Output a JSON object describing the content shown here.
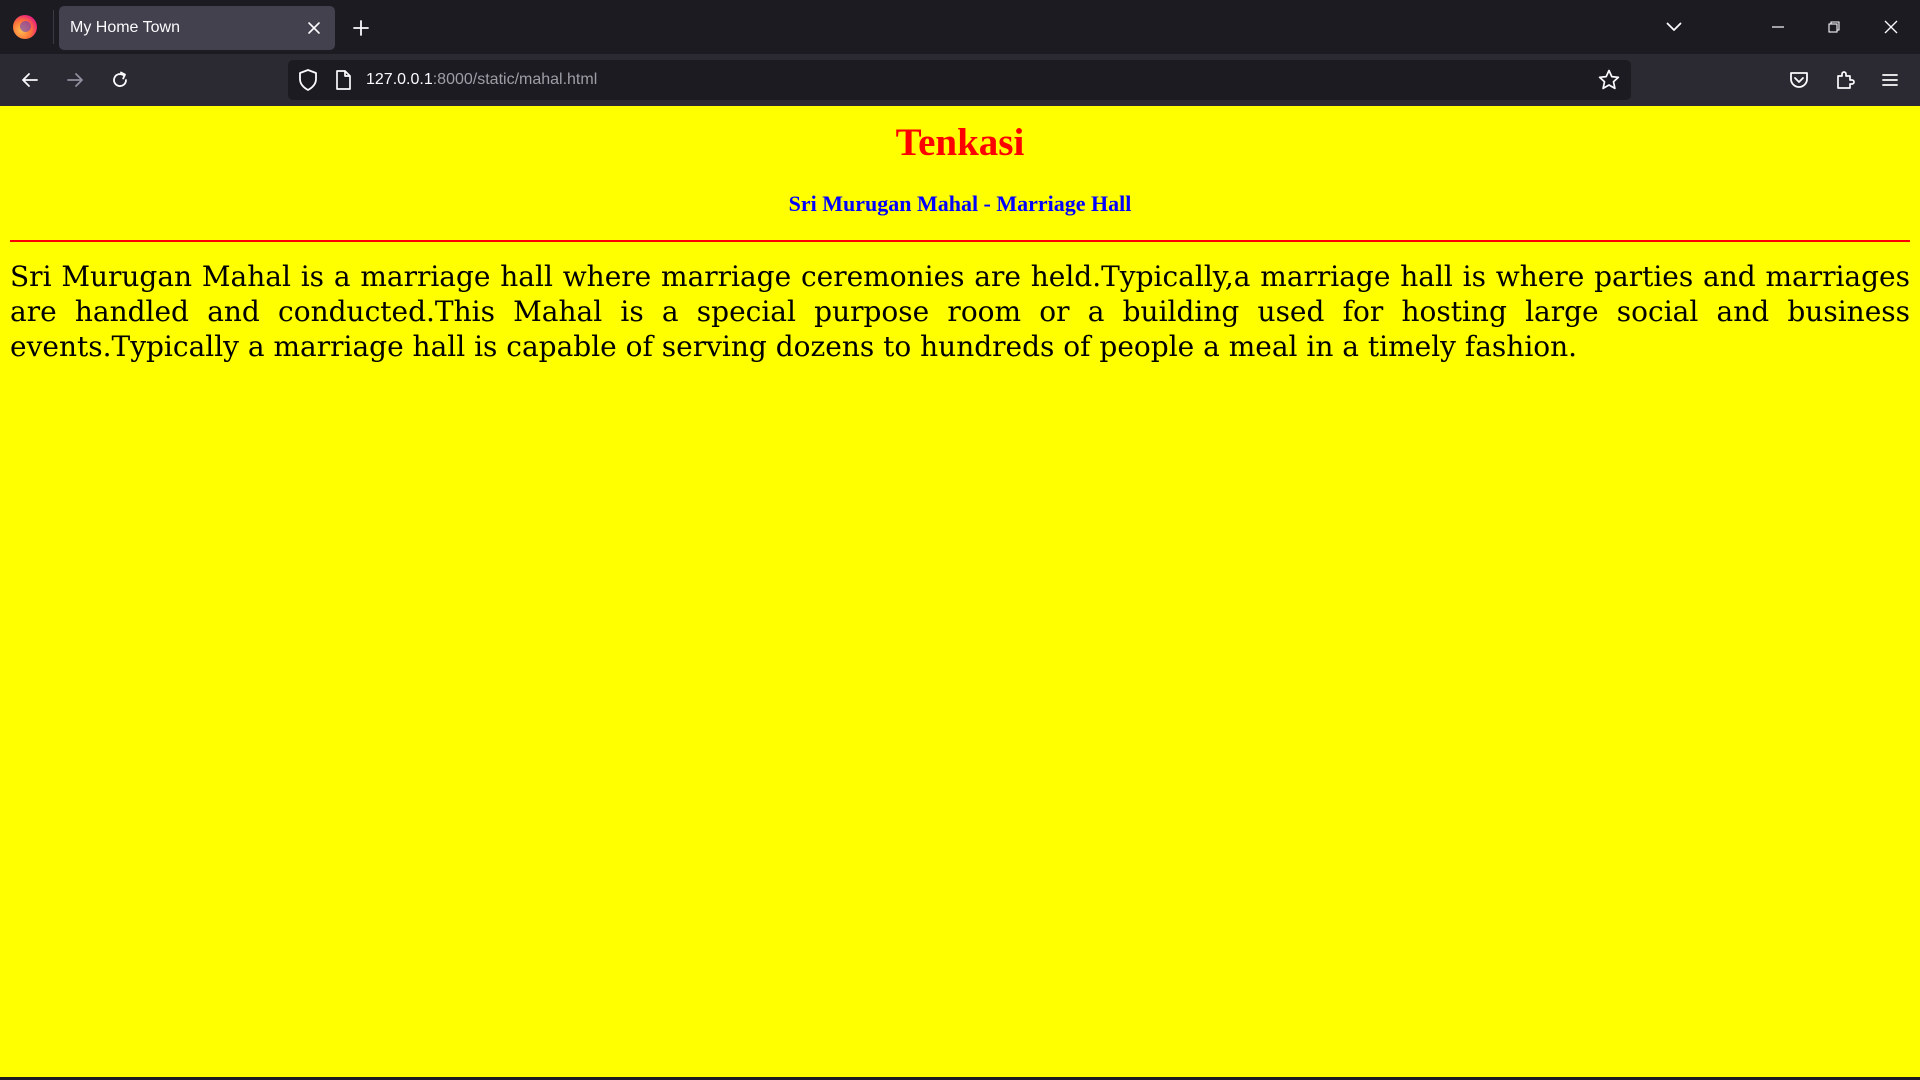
{
  "browser": {
    "tab": {
      "title": "My Home Town"
    },
    "url": {
      "host": "127.0.0.1",
      "rest": ":8000/static/mahal.html"
    },
    "icons": {
      "logo": "firefox-logo-icon",
      "close_tab": "close-icon",
      "new_tab": "plus-icon",
      "list_tabs": "chevron-down-icon",
      "minimize": "minimize-icon",
      "restore": "restore-icon",
      "close_window": "close-icon",
      "back": "arrow-left-icon",
      "forward": "arrow-right-icon",
      "reload": "reload-icon",
      "shield": "shield-icon",
      "page": "page-icon",
      "bookmark": "star-icon",
      "pocket": "pocket-icon",
      "extensions": "puzzle-icon",
      "menu": "hamburger-menu-icon"
    }
  },
  "page": {
    "heading": "Tenkasi",
    "subheading": "Sri Murugan Mahal - Marriage Hall",
    "paragraph": "Sri Murugan Mahal is a marriage hall where marriage ceremonies are held.Typically,a marriage hall is where parties and marriages are handled and conducted.This Mahal is a special purpose room or a building used for hosting large social and business events.Typically a marriage hall is capable of serving dozens to hundreds of people a meal in a timely fashion.",
    "colors": {
      "background": "#ffff00",
      "heading": "#ff0000",
      "subheading": "#0000ff",
      "rule": "#ff0000",
      "text": "#000000"
    }
  }
}
